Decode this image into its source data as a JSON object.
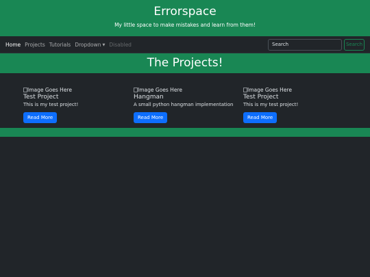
{
  "header": {
    "title": "Errorspace",
    "tagline": "My little space to make mistakes and learn from them!"
  },
  "nav": {
    "items": [
      {
        "label": "Home"
      },
      {
        "label": "Projects"
      },
      {
        "label": "Tutorials"
      },
      {
        "label": "Dropdown"
      },
      {
        "label": "Disabled"
      }
    ],
    "search": {
      "placeholder": "Search",
      "button_label": "Search"
    }
  },
  "banner": {
    "title": "The Projects!"
  },
  "projects": [
    {
      "image_alt": "Image Goes Here",
      "title": "Test Project",
      "description": "This is my test project!",
      "button_label": "Read More"
    },
    {
      "image_alt": "Image Goes Here",
      "title": "Hangman",
      "description": "A small python hangman implementation",
      "button_label": "Read More"
    },
    {
      "image_alt": "Image Goes Here",
      "title": "Test Project",
      "description": "This is my test project!",
      "button_label": "Read More"
    }
  ],
  "colors": {
    "brand_green": "#198754",
    "background": "#212529",
    "primary_button": "#0d6efd"
  }
}
